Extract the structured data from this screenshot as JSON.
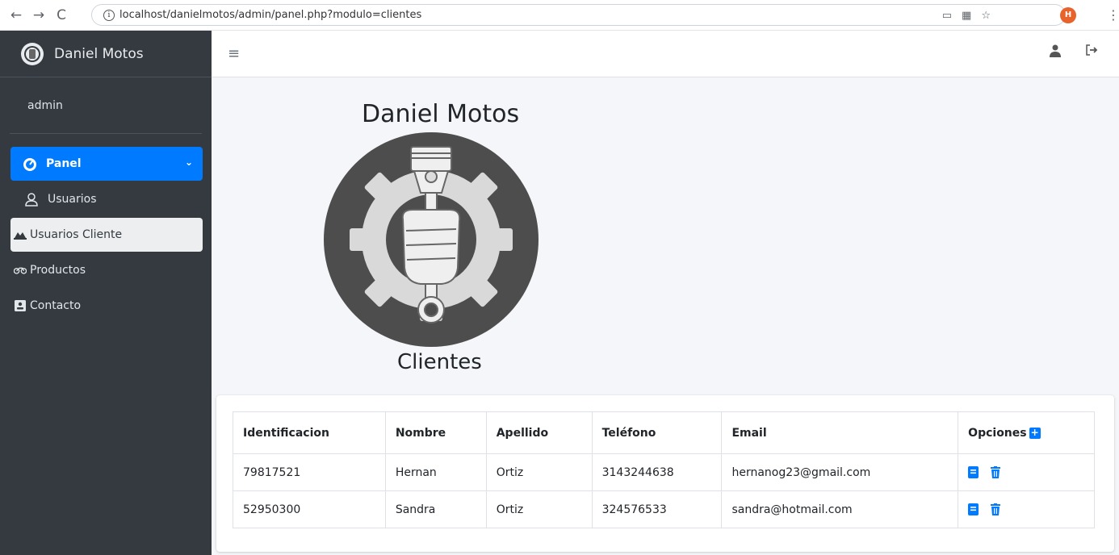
{
  "browser": {
    "url": "localhost/danielmotos/admin/panel.php?modulo=clientes",
    "profile_initial": "H"
  },
  "sidebar": {
    "brand": "Daniel Motos",
    "user": "admin",
    "items": [
      {
        "label": "Panel",
        "icon": "dashboard-icon",
        "state": "active"
      },
      {
        "label": "Usuarios",
        "icon": "user-outline-icon",
        "state": "normal"
      },
      {
        "label": "Usuarios Cliente",
        "icon": "user-group-icon",
        "state": "selected"
      },
      {
        "label": "Productos",
        "icon": "motorcycle-icon",
        "state": "normal"
      },
      {
        "label": "Contacto",
        "icon": "contact-card-icon",
        "state": "normal"
      }
    ]
  },
  "main": {
    "site_title": "Daniel Motos",
    "section_title": "Clientes",
    "table": {
      "headers": [
        "Identificacion",
        "Nombre",
        "Apellido",
        "Teléfono",
        "Email",
        "Opciones"
      ],
      "rows": [
        [
          "79817521",
          "Hernan",
          "Ortiz",
          "3143244638",
          "hernanog23@gmail.com"
        ],
        [
          "52950300",
          "Sandra",
          "Ortiz",
          "324576533",
          "sandra@hotmail.com"
        ]
      ]
    }
  },
  "colors": {
    "sidebar_bg": "#343a40",
    "accent": "#007bff",
    "content_bg": "#f4f6f9"
  }
}
